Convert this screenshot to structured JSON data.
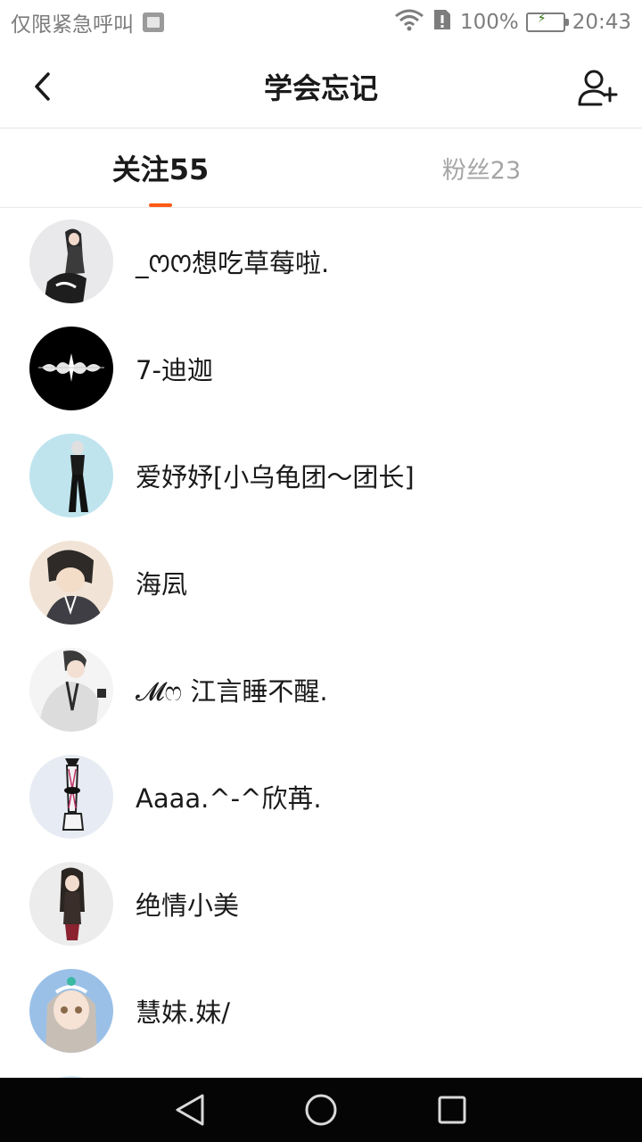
{
  "status_bar": {
    "carrier": "仅限紧急呼叫",
    "battery": "100%",
    "time": "20:43",
    "battery_level": 1.0
  },
  "header": {
    "title": "学会忘记",
    "back_icon": "back-chevron-icon",
    "add_icon": "add-user-icon"
  },
  "tabs": [
    {
      "label": "关注55",
      "active": true
    },
    {
      "label": "粉丝23",
      "active": false
    }
  ],
  "following": [
    {
      "name": "_ꯁꯁ想吃草莓啦."
    },
    {
      "name": "7-迪迦"
    },
    {
      "name": "爱妤妤[小乌龟团～团长]"
    },
    {
      "name": "海凨"
    },
    {
      "name": "𝓜ෆ 江言睡不醒."
    },
    {
      "name": "Aaaa.^-^欣苒."
    },
    {
      "name": "绝情小美"
    },
    {
      "name": "慧妹.妹/"
    }
  ],
  "colors": {
    "accent": "#ff5b14",
    "inactive_tab": "#a5a5a5",
    "battery_green": "#6cc644",
    "nav_bg": "#050505"
  }
}
